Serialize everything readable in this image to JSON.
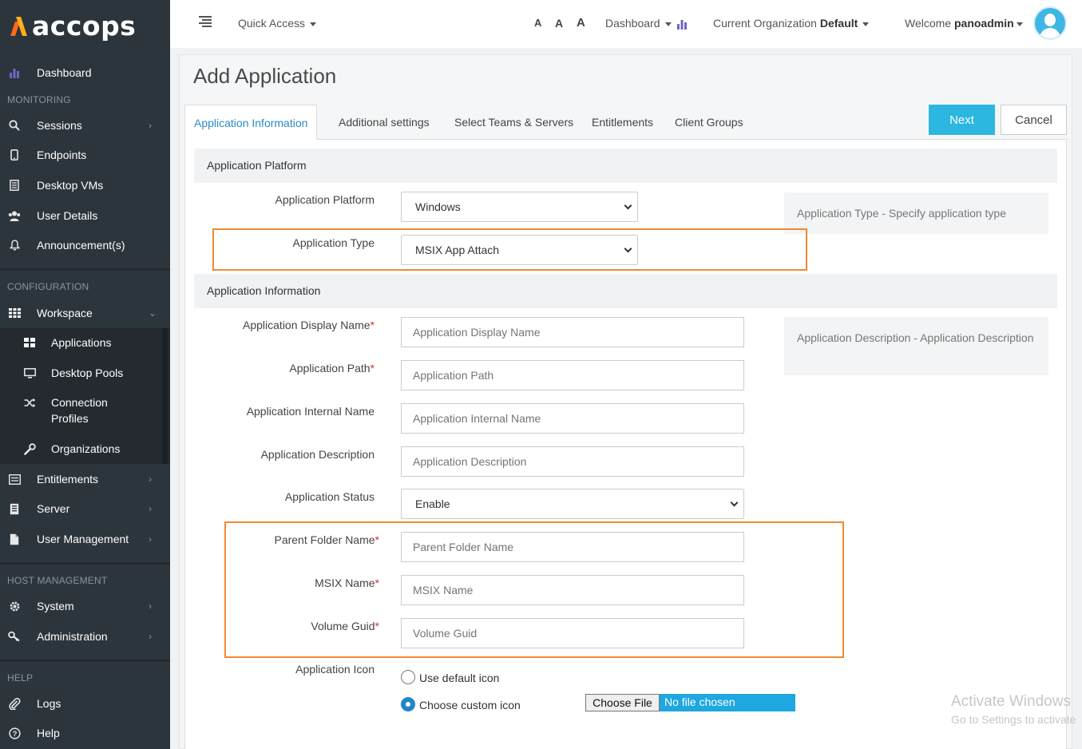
{
  "brand": {
    "name": "accops"
  },
  "sidebar": {
    "dashboard": "Dashboard",
    "monitoring_heading": "MONITORING",
    "monitoring": [
      "Sessions",
      "Endpoints",
      "Desktop VMs",
      "User Details",
      "Announcement(s)"
    ],
    "configuration_heading": "CONFIGURATION",
    "workspace": "Workspace",
    "workspace_items": [
      "Applications",
      "Desktop Pools",
      "Connection Profiles",
      "Organizations"
    ],
    "configuration_more": [
      "Entitlements",
      "Server",
      "User Management"
    ],
    "host_heading": "HOST MANAGEMENT",
    "host": [
      "System",
      "Administration"
    ],
    "help_heading": "HELP",
    "help": [
      "Logs",
      "Help"
    ]
  },
  "header": {
    "quick_access": "Quick Access",
    "font_sizes": [
      "A",
      "A",
      "A"
    ],
    "dashboard": "Dashboard",
    "org_label": "Current Organization",
    "org_value": "Default",
    "welcome": "Welcome",
    "username": "panoadmin"
  },
  "page": {
    "title": "Add Application",
    "tabs": [
      "Application Information",
      "Additional settings",
      "Select Teams & Servers",
      "Entitlements",
      "Client Groups"
    ],
    "next": "Next",
    "cancel": "Cancel"
  },
  "form": {
    "section_platform": "Application Platform",
    "platform_label": "Application Platform",
    "platform_value": "Windows",
    "type_label": "Application Type",
    "type_value": "MSIX App Attach",
    "type_help": "Application Type - Specify application type",
    "section_info": "Application Information",
    "display_name_label": "Application Display Name",
    "display_name_placeholder": "Application Display Name",
    "path_label": "Application Path",
    "path_placeholder": "Application Path",
    "internal_name_label": "Application Internal Name",
    "internal_name_placeholder": "Application Internal Name",
    "description_label": "Application Description",
    "description_placeholder": "Application Description",
    "description_help": "Application Description - Application Description",
    "status_label": "Application Status",
    "status_value": "Enable",
    "parent_folder_label": "Parent Folder Name",
    "parent_folder_placeholder": "Parent Folder Name",
    "msix_name_label": "MSIX Name",
    "msix_name_placeholder": "MSIX Name",
    "volume_guid_label": "Volume Guid",
    "volume_guid_placeholder": "Volume Guid",
    "required_mark": "*",
    "icon_label": "Application Icon",
    "icon_default": "Use default icon",
    "icon_custom": "Choose custom icon",
    "icon_selected": "custom",
    "file_button": "Choose File",
    "file_status": "No file chosen"
  },
  "watermark": {
    "line1": "Activate Windows",
    "line2": "Go to Settings to activate"
  },
  "colors": {
    "sidebar_bg": "#2d353c",
    "accent": "#2bb7e0",
    "tab_active": "#2a8bc6",
    "highlight": "#f08a30",
    "required": "#e02b2b"
  }
}
